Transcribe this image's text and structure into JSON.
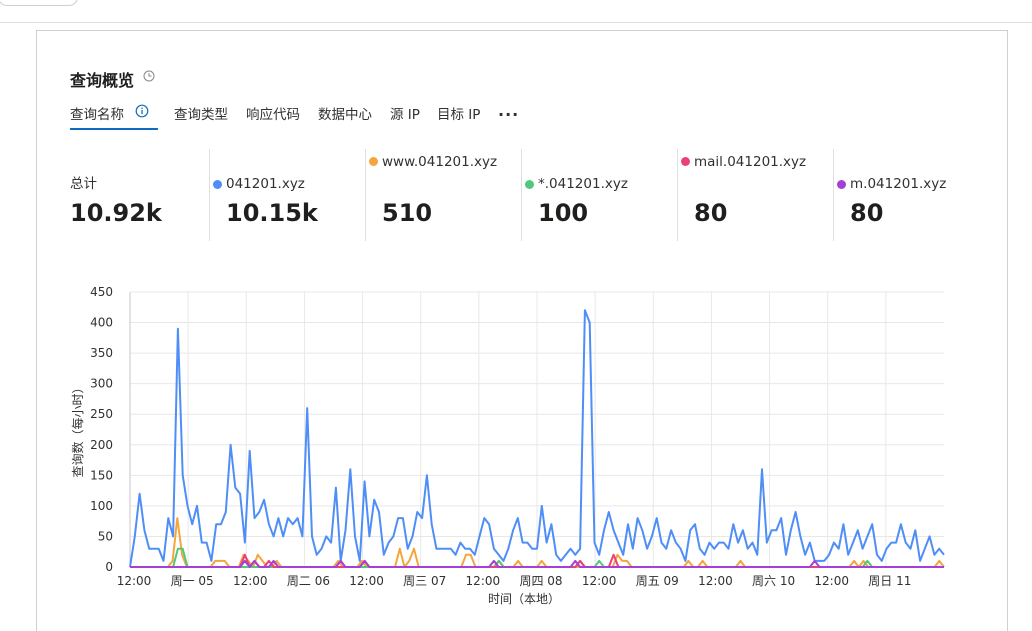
{
  "panel": {
    "title": "查询概览",
    "tabs": [
      "查询名称",
      "查询类型",
      "响应代码",
      "数据中心",
      "源 IP",
      "目标 IP"
    ],
    "more": "..."
  },
  "stats": [
    {
      "label": "总计",
      "value": "10.92k",
      "color": null
    },
    {
      "label": "041201.xyz",
      "value": "10.15k",
      "color": "#4f8ef7"
    },
    {
      "label": "www.041201.xyz",
      "value": "510",
      "color": "#f4a63c"
    },
    {
      "label": "*.041201.xyz",
      "value": "100",
      "color": "#52c97a"
    },
    {
      "label": "mail.041201.xyz",
      "value": "80",
      "color": "#ec407a"
    },
    {
      "label": "m.041201.xyz",
      "value": "80",
      "color": "#a63fd6"
    }
  ],
  "chart_data": {
    "type": "line",
    "ylabel": "查询数（每小时）",
    "xlabel": "时间（本地）",
    "ylim": [
      0,
      450
    ],
    "yticks": [
      0,
      50,
      100,
      150,
      200,
      250,
      300,
      350,
      400,
      450
    ],
    "xtick_labels": [
      "12:00",
      "周一 05",
      "12:00",
      "周二 06",
      "12:00",
      "周三 07",
      "12:00",
      "周四 08",
      "12:00",
      "周五 09",
      "12:00",
      "周六 10",
      "12:00",
      "周日 11"
    ],
    "x_hours": [
      0,
      12,
      24,
      36,
      48,
      60,
      72,
      84,
      96,
      108,
      120,
      132,
      144,
      156
    ],
    "x_range": [
      0,
      168
    ],
    "grid": true,
    "series": [
      {
        "name": "041201.xyz",
        "color": "#4f8ef7",
        "values": [
          0,
          50,
          120,
          60,
          30,
          30,
          30,
          10,
          80,
          50,
          390,
          150,
          100,
          70,
          100,
          40,
          40,
          10,
          70,
          70,
          90,
          200,
          130,
          120,
          40,
          190,
          80,
          90,
          110,
          70,
          50,
          80,
          50,
          80,
          70,
          80,
          50,
          260,
          50,
          20,
          30,
          50,
          40,
          130,
          10,
          60,
          160,
          50,
          10,
          140,
          50,
          110,
          90,
          20,
          40,
          50,
          80,
          80,
          30,
          50,
          90,
          80,
          150,
          70,
          30,
          30,
          30,
          30,
          20,
          40,
          30,
          30,
          20,
          50,
          80,
          70,
          30,
          20,
          10,
          30,
          60,
          80,
          40,
          40,
          30,
          30,
          100,
          40,
          70,
          20,
          10,
          20,
          30,
          20,
          30,
          420,
          400,
          40,
          20,
          60,
          90,
          60,
          40,
          20,
          70,
          30,
          80,
          60,
          30,
          50,
          80,
          40,
          30,
          60,
          40,
          30,
          10,
          60,
          70,
          30,
          20,
          40,
          30,
          40,
          40,
          30,
          70,
          40,
          60,
          30,
          40,
          20,
          160,
          40,
          60,
          60,
          80,
          20,
          60,
          90,
          50,
          20,
          40,
          10,
          10,
          10,
          20,
          40,
          30,
          70,
          20,
          40,
          60,
          30,
          50,
          70,
          20,
          10,
          30,
          40,
          40,
          70,
          40,
          30,
          60,
          10,
          30,
          50,
          20,
          30,
          20
        ]
      },
      {
        "name": "www.041201.xyz",
        "color": "#f4a63c",
        "values": [
          0,
          0,
          0,
          0,
          0,
          0,
          0,
          0,
          0,
          10,
          80,
          20,
          0,
          0,
          0,
          0,
          0,
          0,
          10,
          10,
          10,
          0,
          0,
          0,
          20,
          10,
          0,
          20,
          10,
          0,
          0,
          10,
          0,
          0,
          0,
          0,
          0,
          0,
          0,
          0,
          0,
          0,
          0,
          0,
          10,
          0,
          0,
          0,
          0,
          10,
          0,
          0,
          0,
          0,
          0,
          0,
          0,
          30,
          0,
          10,
          30,
          0,
          0,
          0,
          0,
          0,
          0,
          0,
          0,
          0,
          0,
          20,
          20,
          0,
          0,
          0,
          0,
          0,
          10,
          0,
          0,
          0,
          10,
          0,
          0,
          0,
          0,
          10,
          0,
          0,
          0,
          0,
          0,
          0,
          0,
          0,
          0,
          0,
          0,
          0,
          0,
          0,
          0,
          20,
          10,
          10,
          0,
          0,
          0,
          0,
          0,
          0,
          0,
          0,
          0,
          0,
          0,
          0,
          10,
          0,
          0,
          10,
          0,
          0,
          0,
          0,
          0,
          0,
          0,
          10,
          0,
          0,
          0,
          0,
          0,
          0,
          0,
          0,
          0,
          0,
          0,
          0,
          0,
          0,
          0,
          0,
          0,
          0,
          0,
          0,
          0,
          0,
          0,
          10,
          0,
          10,
          0,
          0,
          0,
          0,
          0,
          0,
          0,
          0,
          0,
          0,
          0,
          0,
          0,
          0,
          0,
          10,
          0
        ]
      },
      {
        "name": "*.041201.xyz",
        "color": "#52c97a",
        "values": [
          0,
          0,
          0,
          0,
          0,
          0,
          0,
          0,
          0,
          0,
          30,
          30,
          0,
          0,
          0,
          0,
          0,
          0,
          0,
          0,
          0,
          0,
          0,
          0,
          0,
          0,
          0,
          0,
          0,
          0,
          0,
          0,
          0,
          0,
          0,
          0,
          0,
          0,
          0,
          0,
          0,
          0,
          0,
          0,
          0,
          0,
          0,
          0,
          0,
          0,
          0,
          0,
          0,
          0,
          0,
          0,
          0,
          0,
          0,
          0,
          0,
          0,
          0,
          0,
          0,
          0,
          0,
          0,
          0,
          0,
          0,
          0,
          0,
          0,
          0,
          0,
          0,
          10,
          0,
          0,
          0,
          0,
          0,
          0,
          0,
          0,
          0,
          0,
          0,
          0,
          0,
          0,
          0,
          0,
          10,
          0,
          0,
          0,
          10,
          0,
          0,
          0,
          0,
          0,
          0,
          0,
          0,
          0,
          0,
          0,
          0,
          0,
          0,
          0,
          0,
          0,
          0,
          0,
          0,
          0,
          0,
          0,
          0,
          0,
          0,
          0,
          0,
          0,
          0,
          0,
          0,
          0,
          0,
          0,
          0,
          0,
          0,
          0,
          0,
          0,
          0,
          0,
          0,
          0,
          0,
          0,
          0,
          0,
          0,
          0,
          0,
          0,
          0,
          0,
          10,
          0,
          0,
          0,
          0,
          0,
          0,
          0,
          0,
          0,
          0,
          0,
          0,
          0,
          0,
          0,
          0
        ]
      },
      {
        "name": "mail.041201.xyz",
        "color": "#ec407a",
        "values": [
          0,
          0,
          0,
          0,
          0,
          0,
          0,
          0,
          0,
          0,
          0,
          0,
          0,
          0,
          0,
          0,
          0,
          0,
          0,
          0,
          0,
          0,
          0,
          0,
          20,
          0,
          10,
          0,
          0,
          10,
          0,
          0,
          0,
          0,
          0,
          0,
          0,
          0,
          0,
          0,
          0,
          0,
          0,
          0,
          0,
          0,
          0,
          0,
          0,
          10,
          0,
          0,
          0,
          0,
          0,
          0,
          0,
          0,
          0,
          0,
          0,
          0,
          0,
          0,
          0,
          0,
          0,
          0,
          0,
          0,
          0,
          0,
          0,
          0,
          0,
          0,
          0,
          0,
          0,
          0,
          0,
          0,
          0,
          0,
          0,
          0,
          0,
          0,
          0,
          0,
          0,
          0,
          0,
          0,
          10,
          0,
          0,
          0,
          0,
          0,
          0,
          20,
          0,
          0,
          0,
          0,
          0,
          0,
          0,
          0,
          0,
          0,
          0,
          0,
          0,
          0,
          0,
          0,
          0,
          0,
          0,
          0,
          0,
          0,
          0,
          0,
          0,
          0,
          0,
          0,
          0,
          0,
          0,
          0,
          0,
          0,
          0,
          0,
          0,
          0,
          0,
          0,
          0,
          0,
          0,
          0,
          0,
          0,
          0,
          0,
          0,
          0,
          0,
          0,
          0,
          0,
          0,
          0,
          0,
          0,
          0,
          0,
          0,
          0,
          0,
          0,
          0,
          0,
          0,
          0,
          0
        ]
      },
      {
        "name": "m.041201.xyz",
        "color": "#a63fd6",
        "values": [
          0,
          0,
          0,
          0,
          0,
          0,
          0,
          0,
          0,
          0,
          0,
          0,
          0,
          0,
          0,
          0,
          0,
          0,
          0,
          0,
          0,
          0,
          0,
          0,
          10,
          0,
          10,
          0,
          0,
          0,
          10,
          0,
          0,
          0,
          0,
          0,
          0,
          0,
          0,
          0,
          0,
          0,
          0,
          0,
          10,
          0,
          0,
          0,
          0,
          10,
          0,
          0,
          0,
          0,
          0,
          0,
          0,
          0,
          0,
          0,
          0,
          0,
          0,
          0,
          0,
          0,
          0,
          0,
          0,
          0,
          0,
          0,
          0,
          0,
          0,
          0,
          10,
          0,
          0,
          0,
          0,
          0,
          0,
          0,
          0,
          0,
          0,
          0,
          0,
          0,
          0,
          0,
          0,
          10,
          0,
          0,
          0,
          0,
          0,
          0,
          0,
          0,
          0,
          0,
          0,
          0,
          0,
          0,
          0,
          0,
          0,
          0,
          0,
          0,
          0,
          0,
          0,
          0,
          0,
          0,
          0,
          0,
          0,
          0,
          0,
          0,
          0,
          0,
          0,
          0,
          0,
          0,
          0,
          0,
          0,
          0,
          0,
          0,
          0,
          0,
          0,
          0,
          0,
          10,
          0,
          0,
          0,
          0,
          0,
          0,
          0,
          0,
          0,
          0,
          0,
          0,
          0,
          0,
          0,
          0,
          0,
          0,
          0,
          0,
          0,
          0,
          0,
          0,
          0,
          0,
          0
        ]
      }
    ]
  }
}
